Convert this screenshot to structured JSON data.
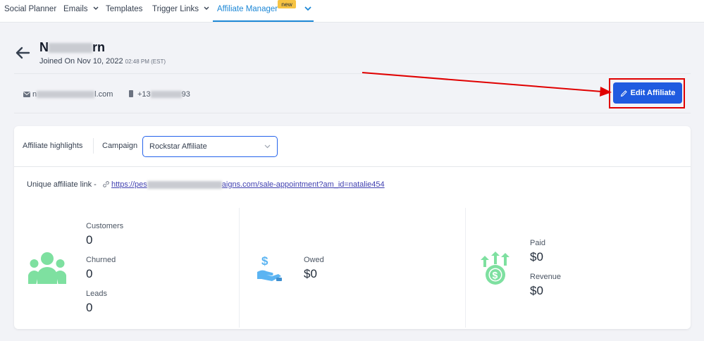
{
  "nav": {
    "items": [
      {
        "label": "Social Planner",
        "has_chevron": false
      },
      {
        "label": "Emails",
        "has_chevron": true
      },
      {
        "label": "Templates",
        "has_chevron": false
      },
      {
        "label": "Trigger Links",
        "has_chevron": true
      },
      {
        "label": "Affiliate Manager",
        "has_chevron": false
      }
    ],
    "active": "Affiliate Manager",
    "badge": "new"
  },
  "profile": {
    "name_start": "N",
    "name_end": "rn",
    "joined": "Joined On Nov 10, 2022",
    "joined_time": "02:48 PM (EST)",
    "email_start": "n",
    "email_end": "l.com",
    "phone_start": "+13",
    "phone_end": "93"
  },
  "actions": {
    "edit_label": "Edit Affiliate"
  },
  "card": {
    "highlights_label": "Affiliate highlights",
    "campaign_label": "Campaign",
    "campaign_value": "Rockstar Affiliate",
    "link_label": "Unique affiliate link -",
    "link_start": "https://pes",
    "link_end": "aigns.com/sale-appointment?am_id=natalie454"
  },
  "stats": {
    "customers": {
      "label": "Customers",
      "value": "0"
    },
    "churned": {
      "label": "Churned",
      "value": "0"
    },
    "leads": {
      "label": "Leads",
      "value": "0"
    },
    "owed": {
      "label": "Owed",
      "value": "$0"
    },
    "paid": {
      "label": "Paid",
      "value": "$0"
    },
    "revenue": {
      "label": "Revenue",
      "value": "$0"
    }
  },
  "colors": {
    "primary": "#1f5be0",
    "accent": "#1e88d6",
    "badge": "#f6c343",
    "icon_green": "#7ee0a0",
    "icon_blue": "#5bb4f2",
    "highlight_red": "#e00000"
  },
  "icons": {
    "back": "arrow-left-icon",
    "email": "mail-icon",
    "phone": "phone-icon",
    "edit": "pencil-icon",
    "link": "link-icon",
    "customers": "group-icon",
    "owed": "hand-dollar-icon",
    "paid": "coin-growth-icon"
  }
}
